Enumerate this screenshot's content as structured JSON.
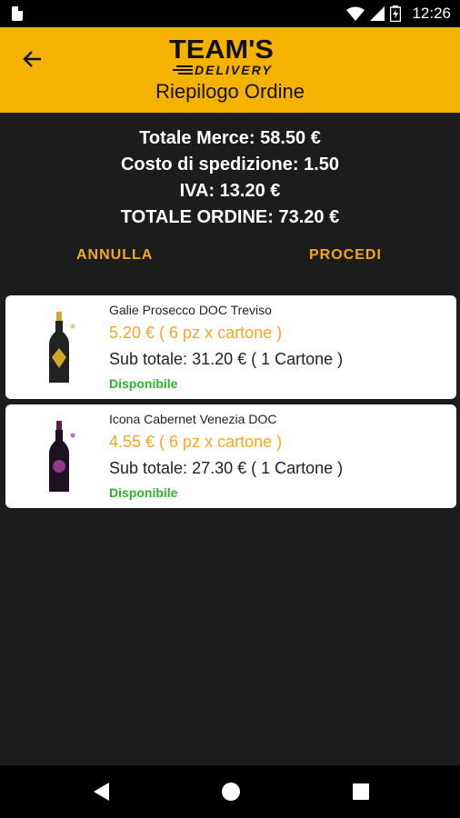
{
  "status_bar": {
    "time": "12:26"
  },
  "header": {
    "logo_top": "TEAM'S",
    "logo_bottom": "DELIVERY",
    "title": "Riepilogo Ordine"
  },
  "summary": {
    "merce": "Totale Merce: 58.50 €",
    "spedizione": "Costo di spedizione: 1.50",
    "iva": "IVA: 13.20 €",
    "totale": "TOTALE ORDINE: 73.20 €"
  },
  "actions": {
    "cancel": "ANNULLA",
    "proceed": "PROCEDI"
  },
  "items": [
    {
      "name": "Galie Prosecco DOC Treviso",
      "price": "5.20 € ( 6 pz x cartone )",
      "subtotal": "Sub totale: 31.20 € ( 1 Cartone )",
      "availability": "Disponibile"
    },
    {
      "name": "Icona Cabernet Venezia DOC",
      "price": "4.55 € ( 6 pz x cartone )",
      "subtotal": "Sub totale: 27.30 € ( 1 Cartone )",
      "availability": "Disponibile"
    }
  ],
  "colors": {
    "accent": "#f5b300",
    "price": "#f5a623",
    "available": "#2bb52b",
    "background": "#1c1c1c"
  },
  "icons": [
    "sim-card-icon",
    "wifi-icon",
    "signal-icon",
    "battery-icon",
    "back-arrow-icon",
    "nav-back-icon",
    "nav-home-icon",
    "nav-recent-icon"
  ]
}
